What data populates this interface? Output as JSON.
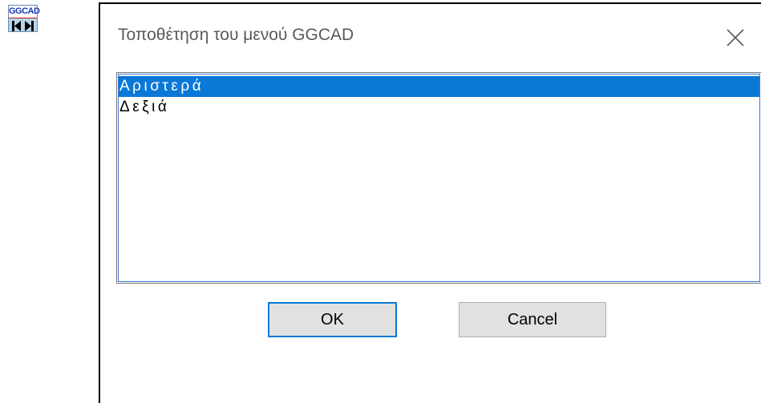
{
  "window": {
    "title": "Τοποθέτηση του μενού GGCAD",
    "close_icon": "close-icon"
  },
  "toolbar_widget": {
    "label": "GGCAD",
    "icons": [
      "skip-to-start-icon",
      "skip-to-end-icon"
    ]
  },
  "list": {
    "items": [
      {
        "label": "Αριστερά",
        "selected": true
      },
      {
        "label": "Δεξιά",
        "selected": false
      }
    ]
  },
  "buttons": {
    "ok_label": "OK",
    "cancel_label": "Cancel"
  },
  "colors": {
    "selection": "#0a78d7",
    "button_face": "#e1e1e1",
    "title_text": "#5a5a5a",
    "focus_border": "#0a78d7"
  }
}
